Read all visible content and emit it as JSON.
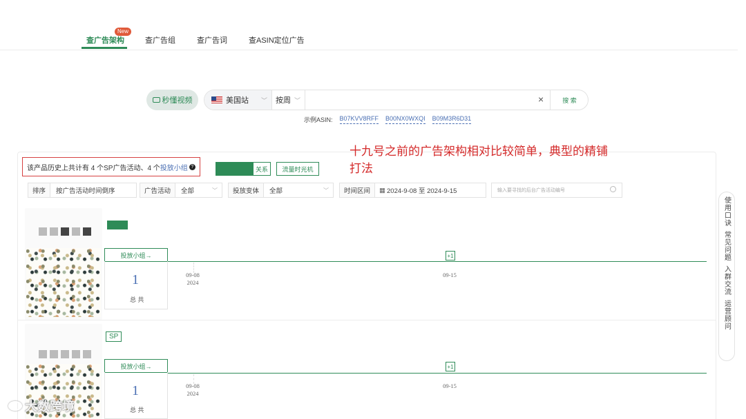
{
  "tabs": [
    {
      "label": "查广告架构",
      "badge": "New",
      "active": true
    },
    {
      "label": "查广告组"
    },
    {
      "label": "查广告词"
    },
    {
      "label": "查ASIN定位广告"
    }
  ],
  "search": {
    "video_btn": "秒懂视频",
    "site": "美国站",
    "period": "按周",
    "input_value": "",
    "clear": "×",
    "submit": "搜 索",
    "example_label": "示例ASIN:",
    "examples": [
      "B07KVV8RFF",
      "B00NX0WXQI",
      "B09M3R6D31"
    ]
  },
  "summary": {
    "prefix": "该产品历史上共计有 4 个SP广告活动、4 个",
    "link": "投放小组",
    "help": "?",
    "relation_btn": "关系",
    "flow_btn": "流量时光机"
  },
  "annotation": "十九号之前的广告架构相对比较简单，典型的精铺打法",
  "filters": {
    "sort_label": "排序",
    "sort_value": "按广告活动时间倒序",
    "campaign_label": "广告活动",
    "campaign_value": "全部",
    "variant_label": "投放变体",
    "variant_value": "全部",
    "time_label": "时间区间",
    "time_value": "2024-9-08 至 2024-9-15",
    "search_placeholder": "输入要寻找的后台广告活动编号"
  },
  "products": [
    {
      "tag": "",
      "group_head": "投放小组→",
      "count": "1",
      "total": "总 共",
      "date_start": "09-08",
      "year": "2024",
      "date_end": "09-15",
      "marker": "+1"
    },
    {
      "tag": "SP",
      "group_head": "投放小组→",
      "count": "1",
      "total": "总 共",
      "date_start": "09-08",
      "year": "2024",
      "date_end": "09-15",
      "marker": "+1"
    }
  ],
  "sidebar": [
    "使用口诀",
    "常见问题",
    "入群交流",
    "运营顾问"
  ],
  "watermark": "大数跨境",
  "colors": {
    "accent": "#2e8b57",
    "link": "#4a6fb3",
    "annotation": "#d42a2a"
  }
}
